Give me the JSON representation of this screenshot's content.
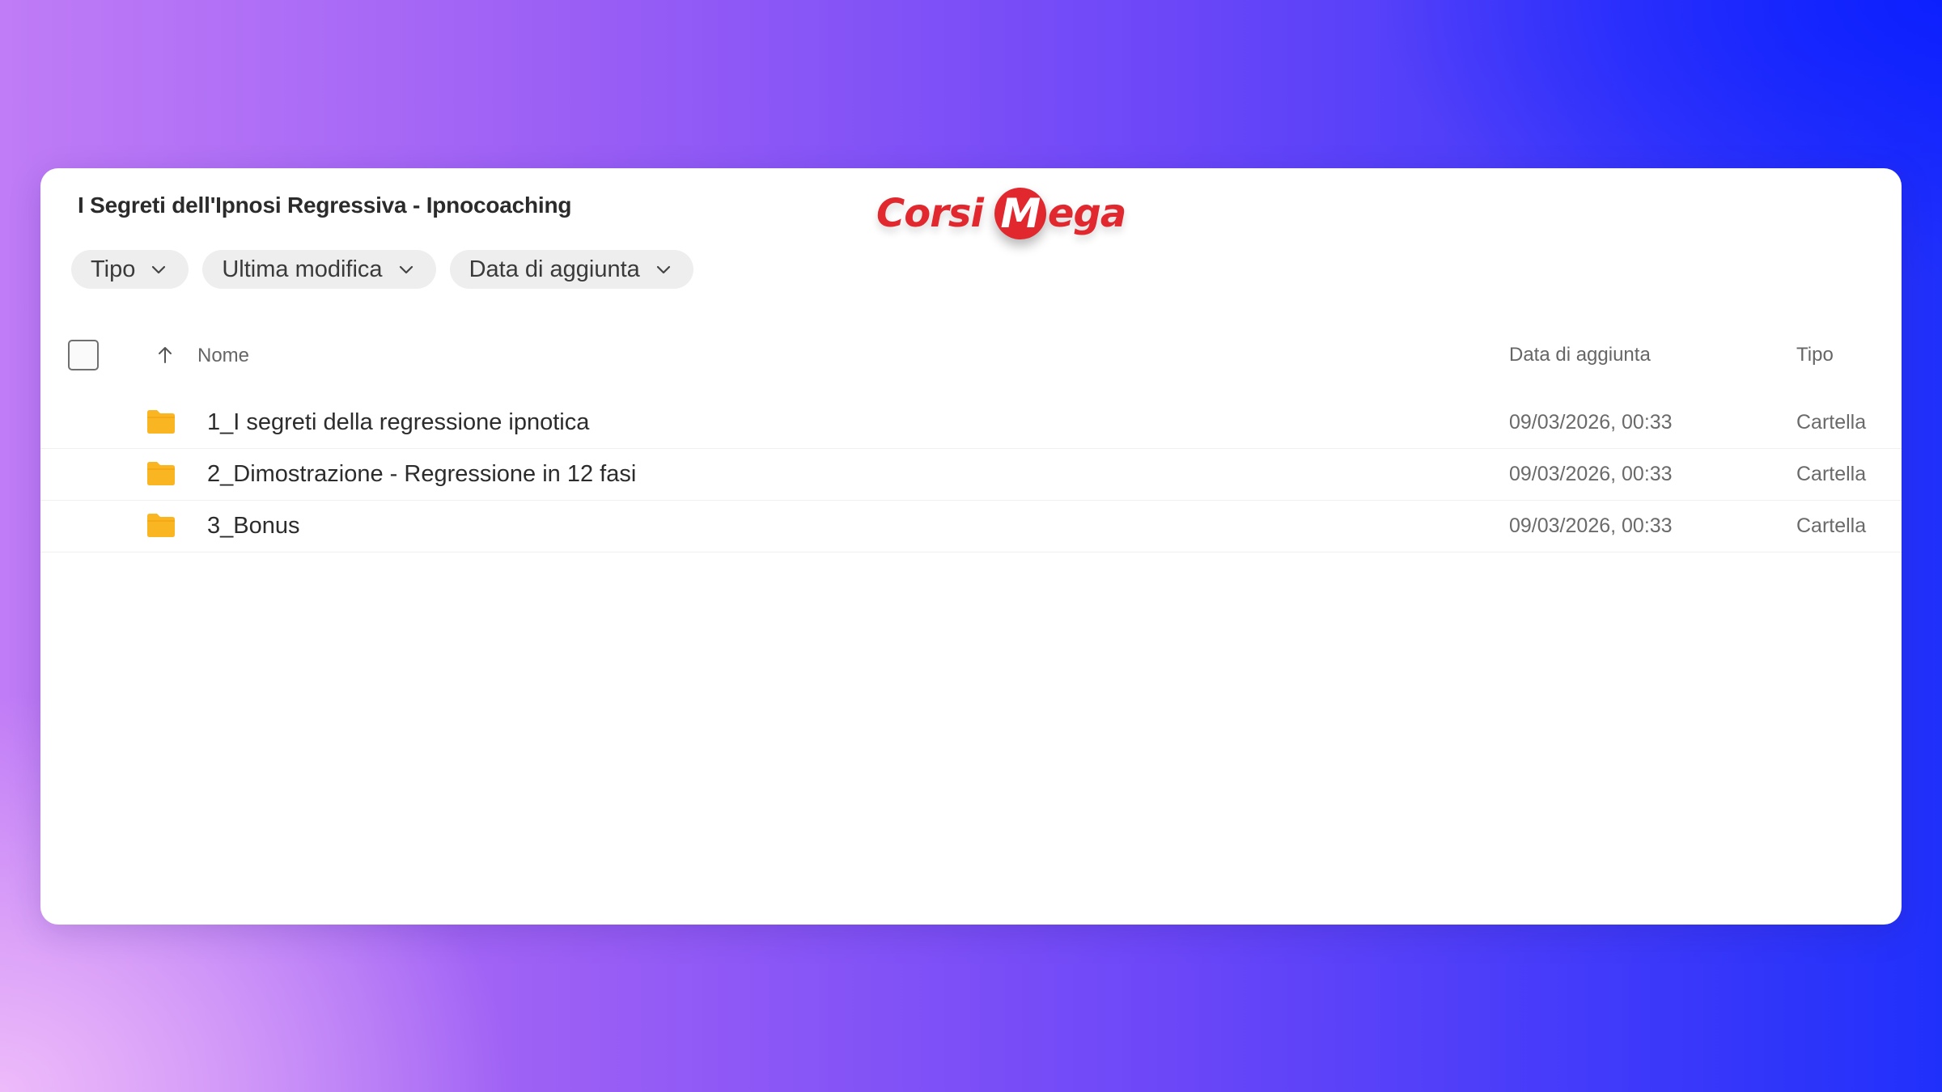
{
  "folder_title": "I Segreti dell'Ipnosi Regressiva - Ipnocoaching",
  "logo": {
    "part1": "Corsi",
    "m": "M",
    "part2": "ega",
    "color": "#e0282e"
  },
  "filters": [
    {
      "label": "Tipo",
      "icon": "chevron-down-icon"
    },
    {
      "label": "Ultima modifica",
      "icon": "chevron-down-icon"
    },
    {
      "label": "Data di aggiunta",
      "icon": "chevron-down-icon"
    }
  ],
  "columns": {
    "name": "Nome",
    "date_added": "Data di aggiunta",
    "type": "Tipo",
    "sort_icon": "arrow-up-icon"
  },
  "rows": [
    {
      "name": "1_I segreti della regressione ipnotica",
      "date_added": "09/03/2026, 00:33",
      "type": "Cartella",
      "icon": "folder-icon"
    },
    {
      "name": "2_Dimostrazione - Regressione in 12 fasi",
      "date_added": "09/03/2026, 00:33",
      "type": "Cartella",
      "icon": "folder-icon"
    },
    {
      "name": "3_Bonus",
      "date_added": "09/03/2026, 00:33",
      "type": "Cartella",
      "icon": "folder-icon"
    }
  ],
  "colors": {
    "folder": "#f9b522",
    "text": "#2c2c2c",
    "muted": "#6a6a6a"
  }
}
